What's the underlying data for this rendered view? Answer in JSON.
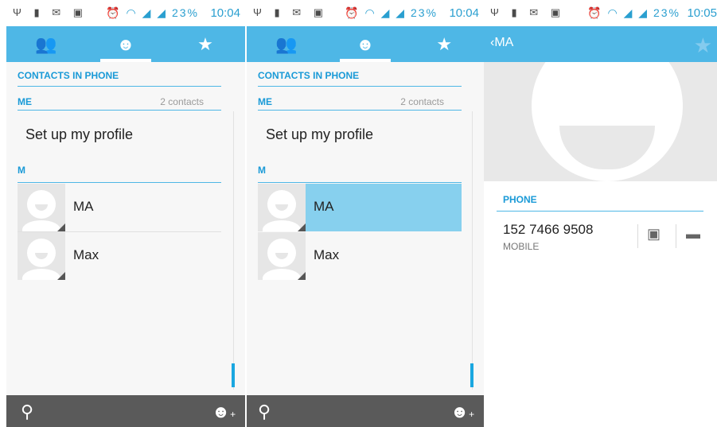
{
  "status": {
    "left_icons": "Ψ ▮ ✉ ▣",
    "right_icons": "⏰ ◠ ◢ ◢",
    "battery_pct": "23%",
    "time1": "10:04",
    "time2": "10:04",
    "time3": "10:05"
  },
  "tabs": [
    {
      "icon": "group-icon",
      "glyph": "👥"
    },
    {
      "icon": "person-icon",
      "glyph": "☻"
    },
    {
      "icon": "star-icon",
      "glyph": "★"
    }
  ],
  "list": {
    "section_contacts": "CONTACTS IN PHONE",
    "section_me": "ME",
    "me_count": "2 contacts",
    "profile": "Set up my profile",
    "section_m": "M",
    "contacts": [
      "MA",
      "Max"
    ]
  },
  "bottom": {
    "search_glyph": "⚲",
    "add_glyph": "+"
  },
  "detail": {
    "back_glyph": "‹",
    "name": "MA",
    "star_glyph": "★",
    "phone_label": "PHONE",
    "number": "152 7466 9508",
    "type": "MOBILE"
  },
  "colors": {
    "accent": "#4eb7e6",
    "selected_row": "#87d0ee",
    "bottombar": "#5a5a5a"
  }
}
